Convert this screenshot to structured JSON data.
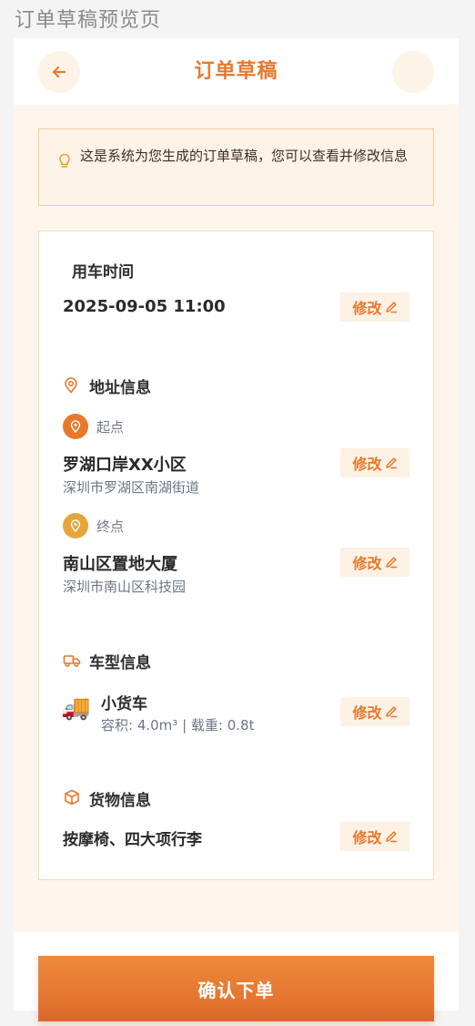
{
  "page_label": "订单草稿预览页",
  "header": {
    "title": "订单草稿"
  },
  "notice": {
    "text": "这是系统为您生成的订单草稿，您可以查看并修改信息"
  },
  "time_section": {
    "title": "用车时间",
    "value": "2025-09-05 11:00"
  },
  "address_section": {
    "title": "地址信息",
    "start": {
      "label": "起点",
      "name": "罗湖口岸XX小区",
      "detail": "深圳市罗湖区南湖街道"
    },
    "end": {
      "label": "终点",
      "name": "南山区置地大厦",
      "detail": "深圳市南山区科技园"
    }
  },
  "vehicle_section": {
    "title": "车型信息",
    "name": "小货车",
    "spec": "容积: 4.0m³ | 载重: 0.8t",
    "emoji": "🚚"
  },
  "cargo_section": {
    "title": "货物信息",
    "value": "按摩椅、四大项行李"
  },
  "edit_label": "修改",
  "confirm_label": "确认下单",
  "colors": {
    "accent": "#e8792c",
    "start_pin": "#e8792c",
    "end_pin": "#e6a53b",
    "background": "#fef6ec"
  },
  "icons": [
    "arrow-left-icon",
    "lightbulb-icon",
    "map-pin-icon",
    "truck-icon",
    "box-icon",
    "pencil-icon"
  ]
}
